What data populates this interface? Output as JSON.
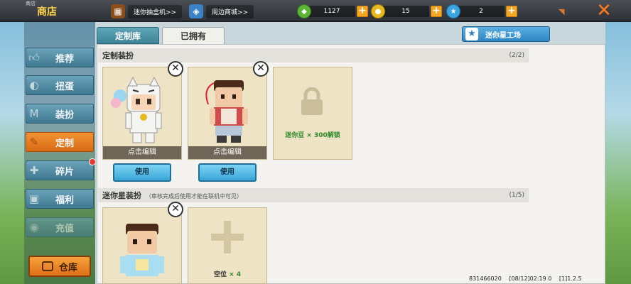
{
  "top": {
    "tiny_label": "商店",
    "title": "商店",
    "links": [
      {
        "label": "迷你抽盒机>>",
        "icon": "gift-machine-icon"
      },
      {
        "label": "周边商城>>",
        "icon": "shopping-bag-icon"
      }
    ],
    "currencies": [
      {
        "name": "green-gem",
        "amount": "1127",
        "color": "#5cb535"
      },
      {
        "name": "mini-coin",
        "amount": "15",
        "color": "#e8b91f"
      },
      {
        "name": "star-coin",
        "amount": "2",
        "color": "#3aa3e0"
      }
    ]
  },
  "tabs": [
    {
      "label": "定制库"
    },
    {
      "label": "已拥有"
    }
  ],
  "star_button": "迷你星工场",
  "nav": [
    {
      "label": "推荐",
      "icon": "thumbs-up-icon"
    },
    {
      "label": "扭蛋",
      "icon": "capsule-icon"
    },
    {
      "label": "装扮",
      "icon": "shirt-icon"
    },
    {
      "label": "定制",
      "icon": "pencil-icon"
    },
    {
      "label": "碎片",
      "icon": "puzzle-icon"
    },
    {
      "label": "福利",
      "icon": "gift-icon"
    },
    {
      "label": "充值",
      "icon": "coin-icon"
    }
  ],
  "warehouse": "仓库",
  "section1": {
    "title": "定制装扮",
    "count": "(2/2)",
    "cards": [
      {
        "caption": "点击编辑",
        "use": "使用"
      },
      {
        "caption": "点击编辑",
        "use": "使用"
      }
    ],
    "lock_label": "迷你豆 × 300解锁"
  },
  "section2": {
    "title": "迷你星装扮",
    "note": "（审核完成后使用才能在联机中可见）",
    "count": "(1/5)",
    "slot_label_prefix": "空位",
    "slot_label_count": "× 4"
  },
  "footer": {
    "id": "831466020",
    "time": "[08/12]02:19 0",
    "version": "[1]1.2.5"
  },
  "colors": {
    "accent_orange": "#e07018",
    "tab_teal": "#3d8397",
    "use_blue": "#3aa6d8"
  }
}
